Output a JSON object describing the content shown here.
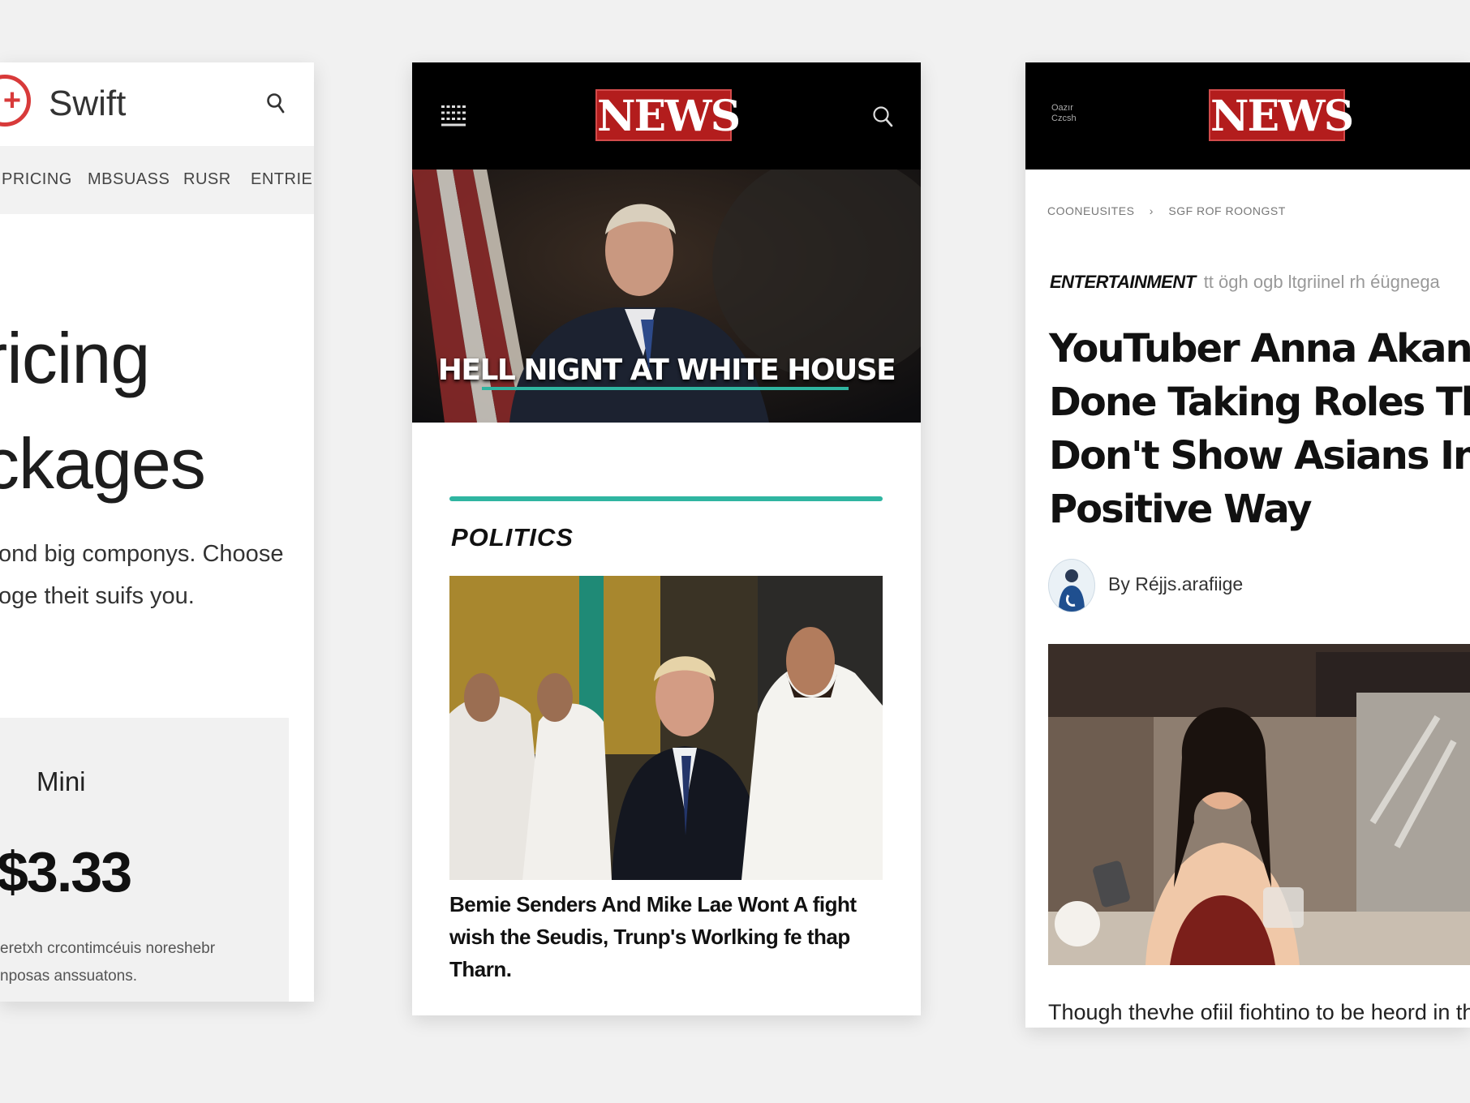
{
  "swift_card": {
    "brand": "Swift",
    "nav": [
      "PRICING",
      "MBSUASS",
      "RUSR",
      "ENTRIEDT"
    ],
    "hero_lines": [
      "ricing",
      "ckages"
    ],
    "desc_lines": [
      "ond big componys. Choose",
      "oge theit suifs you."
    ],
    "plan": {
      "name": "Mini",
      "price": "$3.33",
      "note_lines": [
        "eretxh crcontimcéuis noreshebr",
        "nposas anssuatons."
      ]
    },
    "icons": {
      "logo": "plus-circle-icon",
      "search": "search-icon"
    },
    "colors": {
      "accent": "#d83a3a"
    }
  },
  "politics_card": {
    "logo": "NEWS",
    "hero_caption": "HELL NIGNT AT WHITE HOUSE",
    "section": "POLITICS",
    "headline_lines": [
      "Bemie Senders And Mike Lae Wont A fight",
      "wish the Seudis, Trunp's Worlking fe thap",
      "Tharn."
    ],
    "icons": {
      "menu": "grid-menu-icon",
      "search": "search-icon"
    },
    "colors": {
      "brand": "#b31d1d",
      "accent": "#2fb5a1"
    }
  },
  "entertainment_card": {
    "logo": "NEWS",
    "top_left_text": "Oazır Czcsh",
    "breadcrumb": [
      "COONEUSITES",
      "SGF ROF ROONGST"
    ],
    "kicker_label": "ENTERTAINMENT",
    "kicker_text": "tt ögh ogb ltgriinel rh éügnega",
    "title_lines": [
      "YouTuber Anna Akana",
      "Done Taking Roles That",
      "Don't Show Asians In A",
      "Positive Way"
    ],
    "byline": "By Réjjs.arafiige",
    "lead": "Though thevhe ofiil fiohtino to be heord in the",
    "icons": {
      "avatar": "author-avatar-icon"
    }
  }
}
